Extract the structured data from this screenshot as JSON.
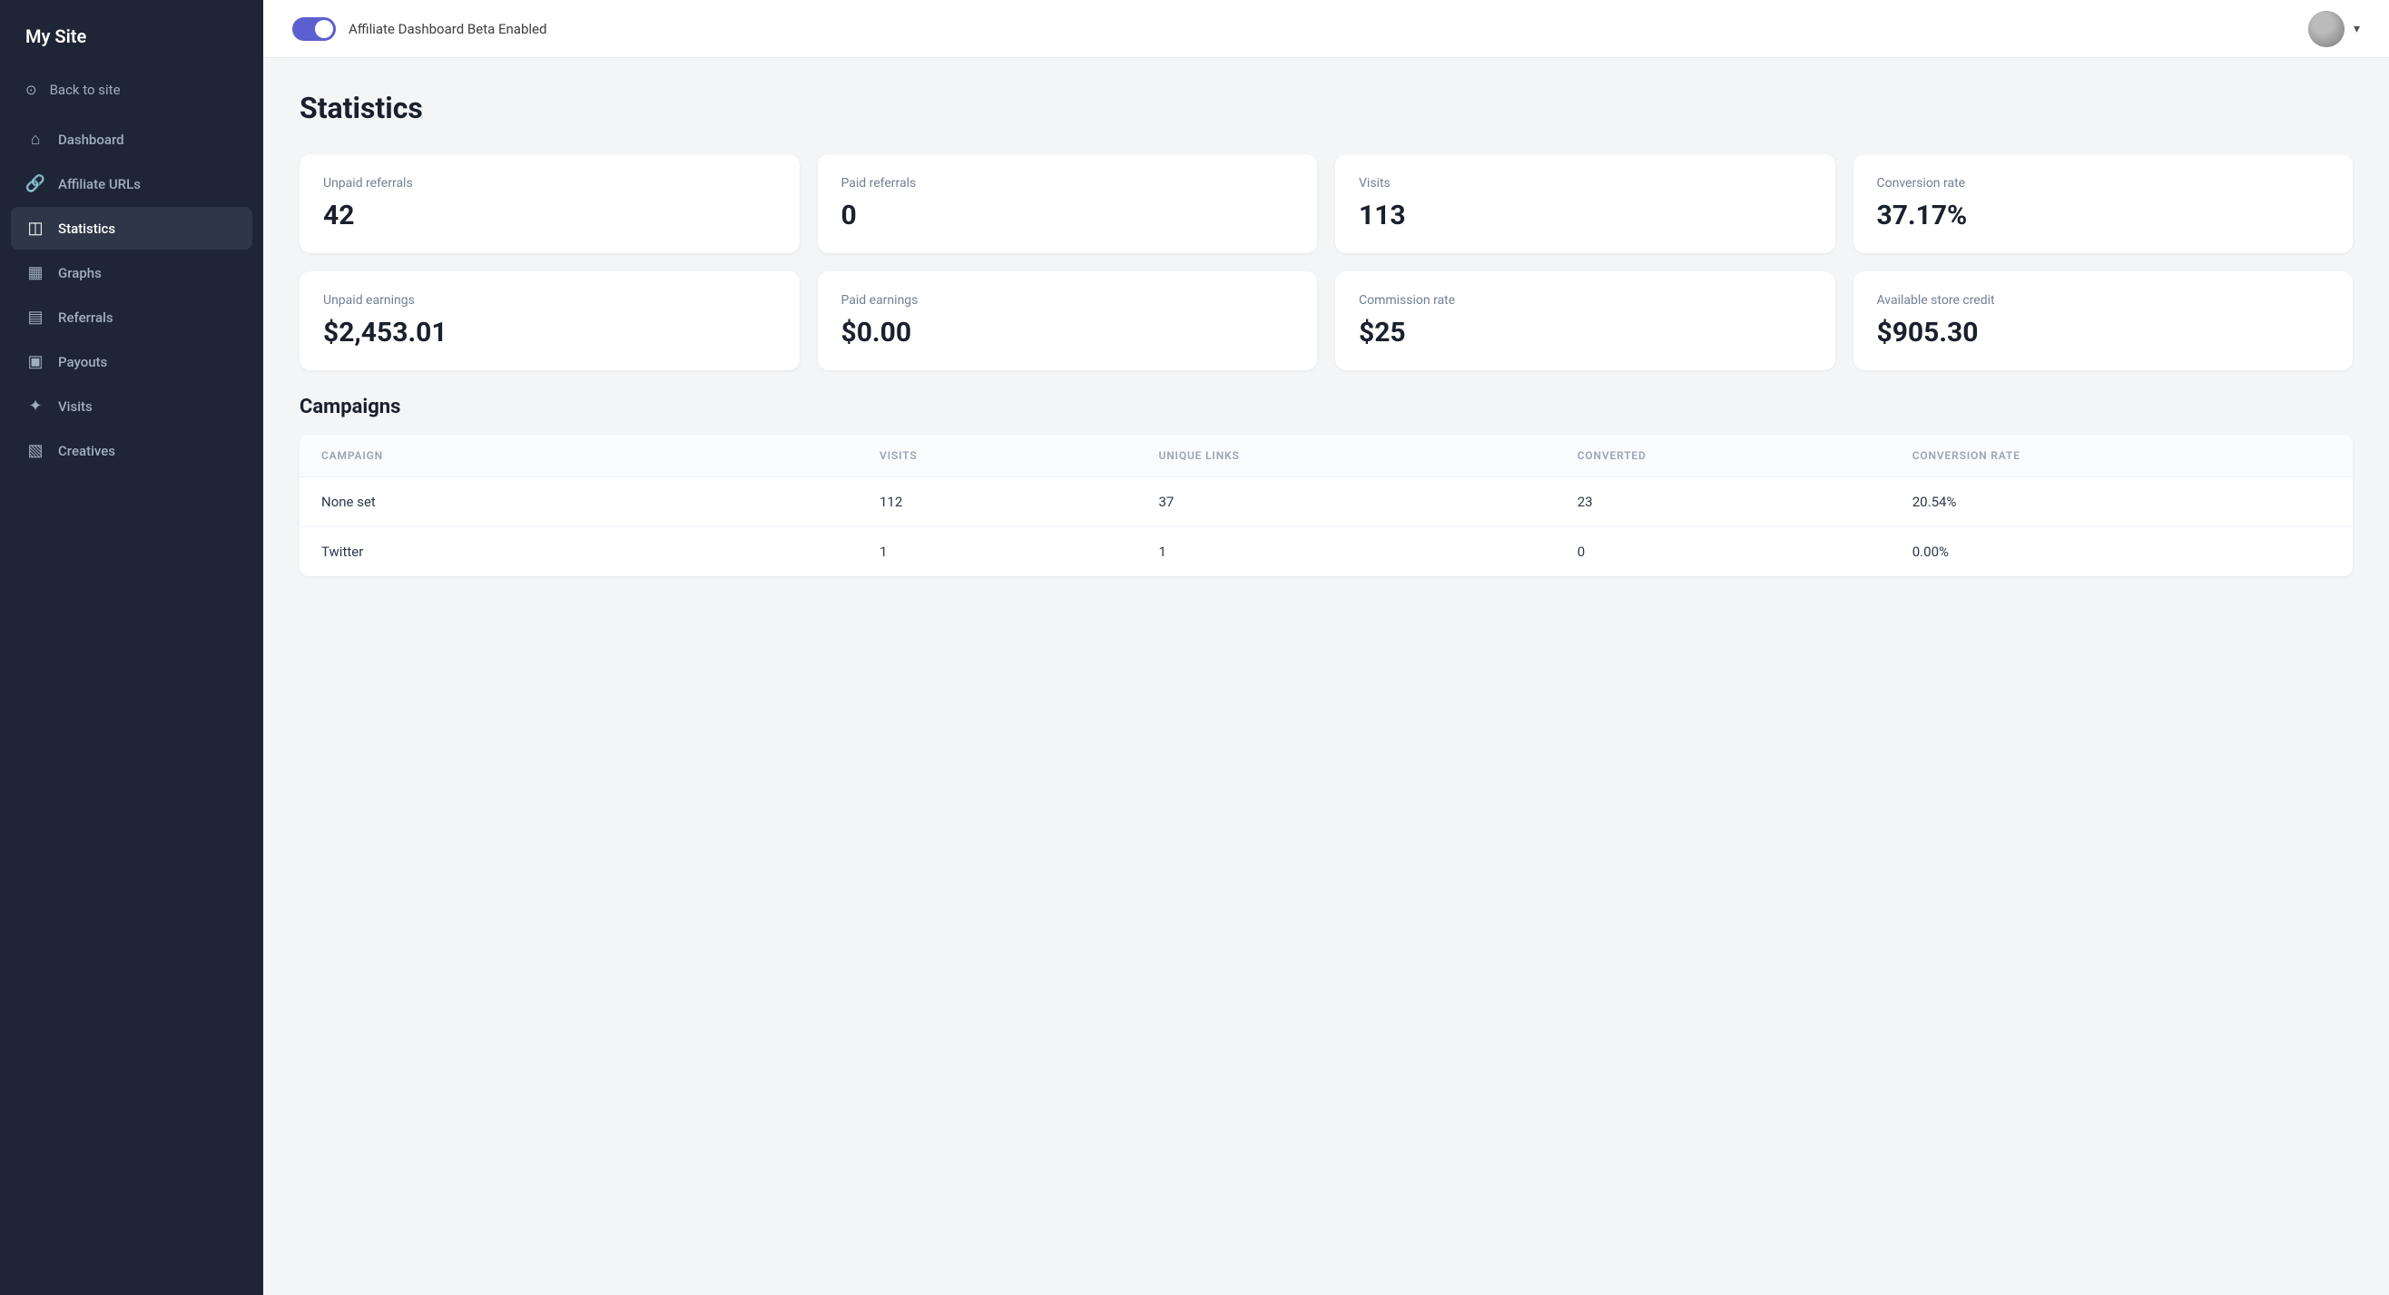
{
  "site": {
    "title": "My Site"
  },
  "header": {
    "toggle_label": "Affiliate Dashboard Beta Enabled",
    "toggle_enabled": true
  },
  "sidebar": {
    "back_label": "Back to site",
    "items": [
      {
        "id": "dashboard",
        "label": "Dashboard",
        "icon": "⌂",
        "active": false
      },
      {
        "id": "affiliate-urls",
        "label": "Affiliate URLs",
        "icon": "🔗",
        "active": false
      },
      {
        "id": "statistics",
        "label": "Statistics",
        "icon": "📊",
        "active": true
      },
      {
        "id": "graphs",
        "label": "Graphs",
        "icon": "📈",
        "active": false
      },
      {
        "id": "referrals",
        "label": "Referrals",
        "icon": "🖥",
        "active": false
      },
      {
        "id": "payouts",
        "label": "Payouts",
        "icon": "💳",
        "active": false
      },
      {
        "id": "visits",
        "label": "Visits",
        "icon": "✦",
        "active": false
      },
      {
        "id": "creatives",
        "label": "Creatives",
        "icon": "📋",
        "active": false
      }
    ]
  },
  "page": {
    "title": "Statistics"
  },
  "stats_row1": [
    {
      "label": "Unpaid referrals",
      "value": "42"
    },
    {
      "label": "Paid referrals",
      "value": "0"
    },
    {
      "label": "Visits",
      "value": "113"
    },
    {
      "label": "Conversion rate",
      "value": "37.17%"
    }
  ],
  "stats_row2": [
    {
      "label": "Unpaid earnings",
      "value": "$2,453.01"
    },
    {
      "label": "Paid earnings",
      "value": "$0.00"
    },
    {
      "label": "Commission rate",
      "value": "$25"
    },
    {
      "label": "Available store credit",
      "value": "$905.30"
    }
  ],
  "campaigns": {
    "title": "Campaigns",
    "columns": [
      "CAMPAIGN",
      "VISITS",
      "UNIQUE LINKS",
      "CONVERTED",
      "CONVERSION RATE"
    ],
    "rows": [
      {
        "campaign": "None set",
        "visits": "112",
        "unique_links": "37",
        "converted": "23",
        "conversion_rate": "20.54%"
      },
      {
        "campaign": "Twitter",
        "visits": "1",
        "unique_links": "1",
        "converted": "0",
        "conversion_rate": "0.00%"
      }
    ]
  }
}
